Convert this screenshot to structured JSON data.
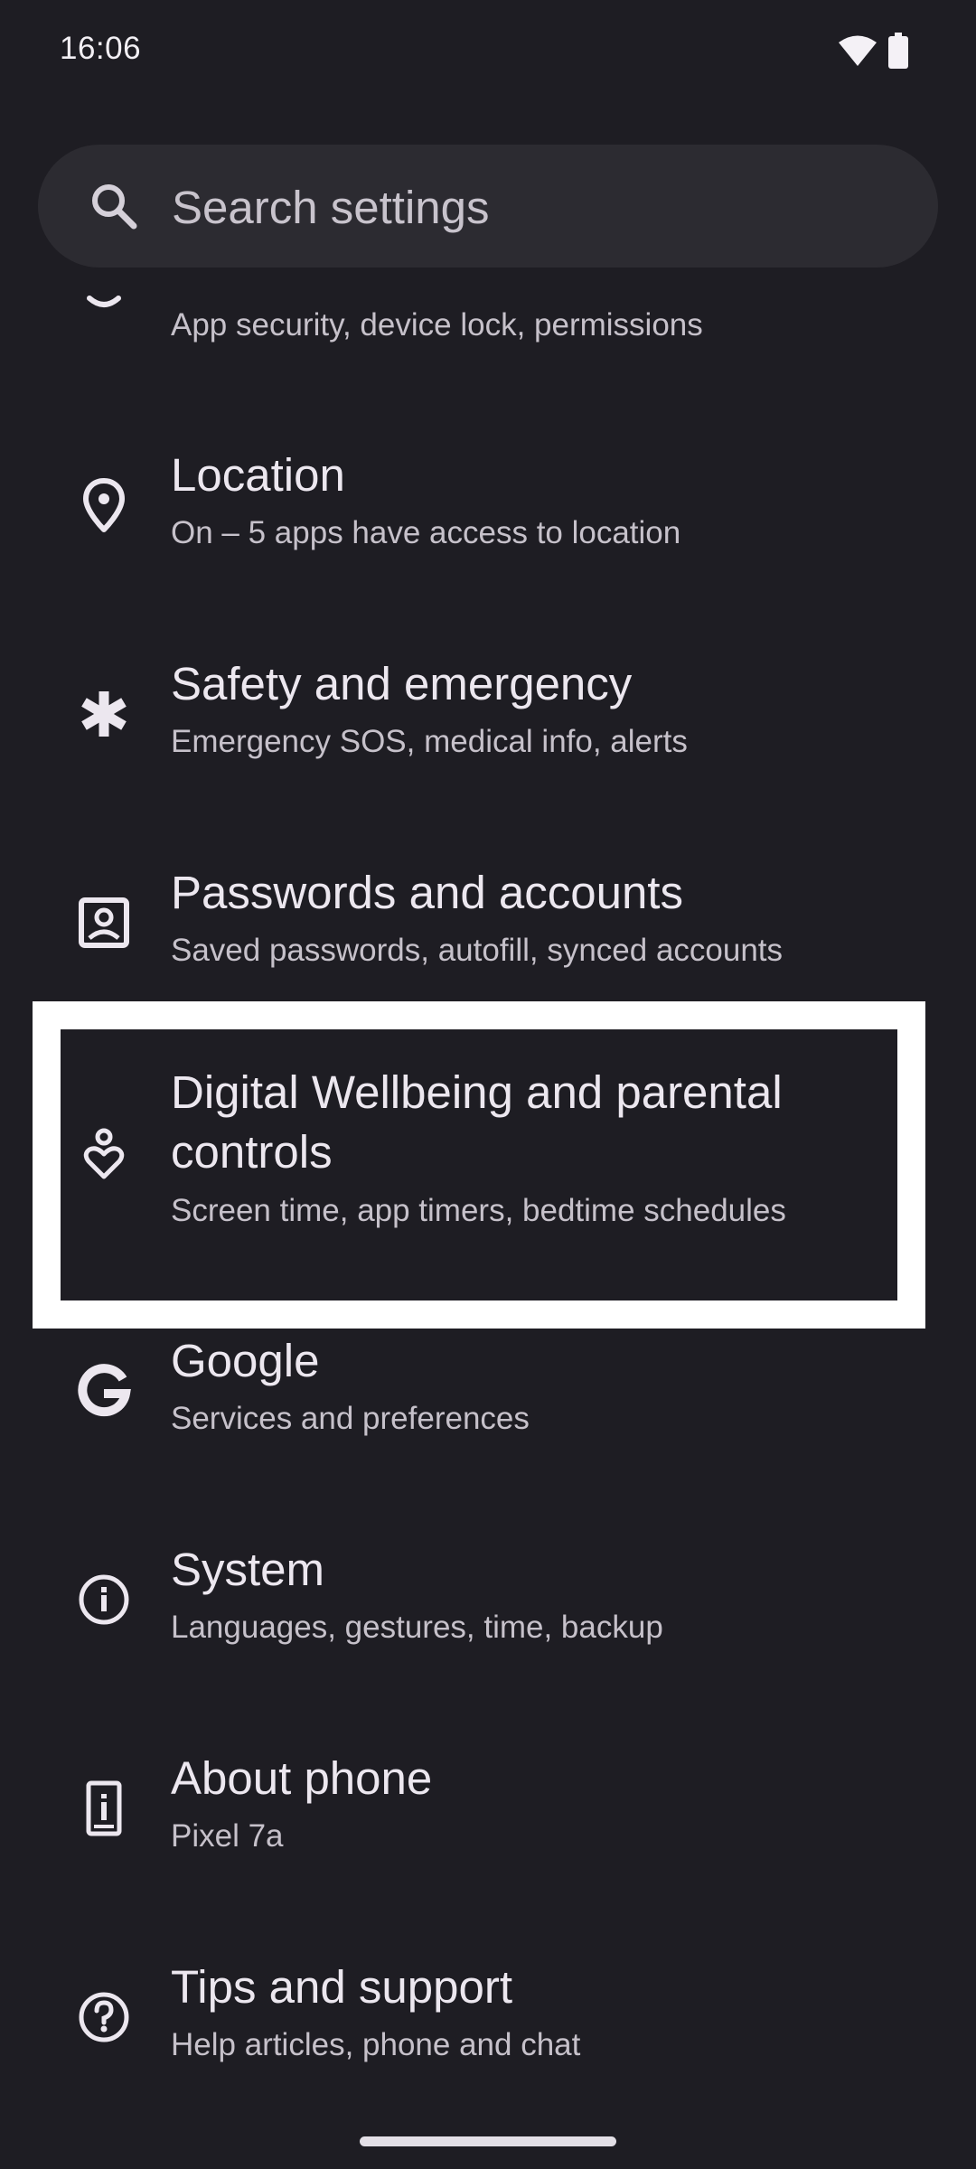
{
  "status_bar": {
    "time": "16:06"
  },
  "search": {
    "placeholder": "Search settings"
  },
  "settings_items": [
    {
      "title": "",
      "subtitle": "App security, device lock, permissions",
      "icon": "shield-icon"
    },
    {
      "title": "Location",
      "subtitle": "On – 5 apps have access to location",
      "icon": "location-pin-icon"
    },
    {
      "title": "Safety and emergency",
      "subtitle": "Emergency SOS, medical info, alerts",
      "icon": "asterisk-icon"
    },
    {
      "title": "Passwords and accounts",
      "subtitle": "Saved passwords, autofill, synced accounts",
      "icon": "account-box-icon"
    },
    {
      "title": "Digital Wellbeing and parental controls",
      "subtitle": "Screen time, app timers, bedtime schedules",
      "icon": "wellbeing-icon"
    },
    {
      "title": "Google",
      "subtitle": "Services and preferences",
      "icon": "google-g-icon"
    },
    {
      "title": "System",
      "subtitle": "Languages, gestures, time, backup",
      "icon": "info-icon"
    },
    {
      "title": "About phone",
      "subtitle": "Pixel 7a",
      "icon": "phone-info-icon"
    },
    {
      "title": "Tips and support",
      "subtitle": "Help articles, phone and chat",
      "icon": "help-icon"
    }
  ],
  "colors": {
    "background": "#1e1d23",
    "search_bar": "#2c2b31",
    "highlight": "#ffffff"
  }
}
